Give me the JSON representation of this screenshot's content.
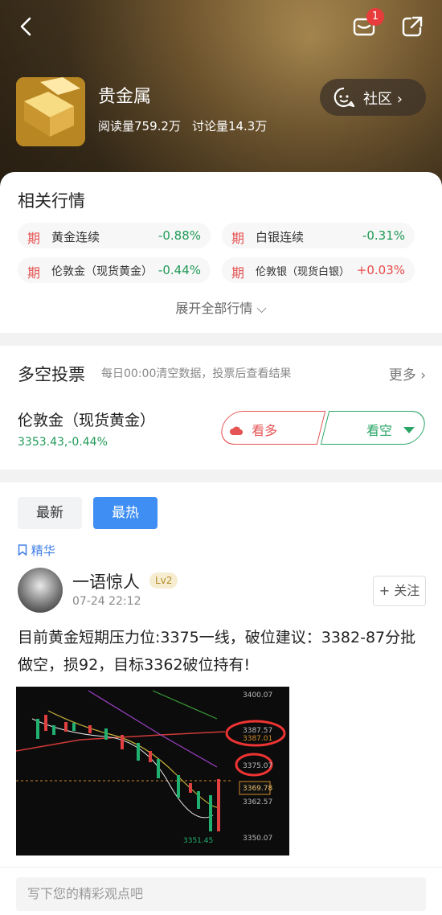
{
  "header": {
    "mail_badge": "1",
    "title": "贵金属",
    "read_count": "阅读量759.2万",
    "discuss_count": "讨论量14.3万",
    "community_label": "社区 ›"
  },
  "related": {
    "title": "相关行情",
    "quotes": [
      {
        "tag": "期",
        "name": "黄金连续",
        "change": "-0.88%",
        "dir": "down"
      },
      {
        "tag": "期",
        "name": "白银连续",
        "change": "-0.31%",
        "dir": "down"
      },
      {
        "tag": "期",
        "name": "伦敦金（现货黄金）",
        "change": "-0.44%",
        "dir": "down"
      },
      {
        "tag": "期",
        "name": "伦敦银（现货白银）",
        "change": "+0.03%",
        "dir": "up"
      }
    ],
    "expand_label": "展开全部行情 ⌵"
  },
  "vote": {
    "title": "多空投票",
    "subtitle": "每日00:00清空数据，投票后查看结果",
    "more_label": "更多 ›",
    "asset_name": "伦敦金（现货黄金）",
    "asset_price": "3353.43,-0.44%",
    "bull_label": "看多",
    "bear_label": "看空"
  },
  "feed": {
    "tab_latest": "最新",
    "tab_hot": "最热",
    "essence_label": "精华",
    "post": {
      "user": "一语惊人",
      "level": "Lv2",
      "time": "07-24 22:12",
      "follow_label": "+ 关注",
      "text": "目前黄金短期压力位:3375一线，破位建议：3382-87分批做空，损92，目标3362破位持有!",
      "chart_prices": [
        "3400.07",
        "3387.57",
        "3387.01",
        "3375.07",
        "3369.78",
        "3362.57",
        "3351.45",
        "3350.07"
      ]
    }
  },
  "bottom": {
    "input_placeholder": "写下您的精彩观点吧"
  }
}
